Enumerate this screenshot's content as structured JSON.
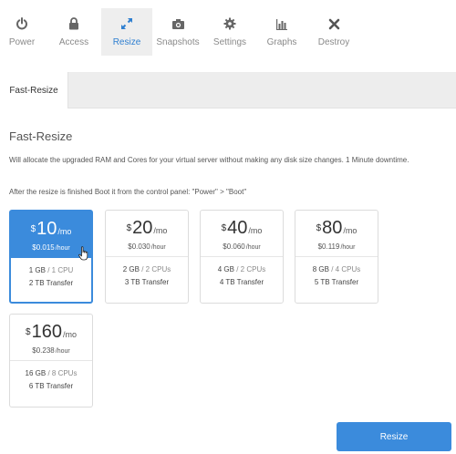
{
  "nav": {
    "items": [
      {
        "label": "Power",
        "icon": "power-icon"
      },
      {
        "label": "Access",
        "icon": "lock-icon"
      },
      {
        "label": "Resize",
        "icon": "resize-arrows-icon",
        "active": true
      },
      {
        "label": "Snapshots",
        "icon": "camera-icon"
      },
      {
        "label": "Settings",
        "icon": "gear-icon"
      },
      {
        "label": "Graphs",
        "icon": "bar-chart-icon"
      },
      {
        "label": "Destroy",
        "icon": "close-icon"
      }
    ]
  },
  "tabs": [
    {
      "label": "Fast-Resize",
      "active": true
    }
  ],
  "section": {
    "title": "Fast-Resize",
    "description": "Will allocate the upgraded RAM and Cores for your virtual server without making any disk size changes. 1 Minute downtime.",
    "note": "After the resize is finished Boot it from the control panel: \"Power\" > \"Boot\""
  },
  "plans": [
    {
      "currency": "$",
      "price": "10",
      "per": "/mo",
      "hourly": "$0.015",
      "hour_unit": "/hour",
      "ram": "1 GB",
      "cpu": "/ 1 CPU",
      "transfer": "2 TB Transfer",
      "selected": true
    },
    {
      "currency": "$",
      "price": "20",
      "per": "/mo",
      "hourly": "$0.030",
      "hour_unit": "/hour",
      "ram": "2 GB",
      "cpu": "/ 2 CPUs",
      "transfer": "3 TB Transfer"
    },
    {
      "currency": "$",
      "price": "40",
      "per": "/mo",
      "hourly": "$0.060",
      "hour_unit": "/hour",
      "ram": "4 GB",
      "cpu": "/ 2 CPUs",
      "transfer": "4 TB Transfer"
    },
    {
      "currency": "$",
      "price": "80",
      "per": "/mo",
      "hourly": "$0.119",
      "hour_unit": "/hour",
      "ram": "8 GB",
      "cpu": "/ 4 CPUs",
      "transfer": "5 TB Transfer"
    },
    {
      "currency": "$",
      "price": "160",
      "per": "/mo",
      "hourly": "$0.238",
      "hour_unit": "/hour",
      "ram": "16 GB",
      "cpu": "/ 8 CPUs",
      "transfer": "6 TB Transfer"
    }
  ],
  "actions": {
    "resize_label": "Resize"
  },
  "colors": {
    "accent": "#3b8bdc",
    "nav_icon": "#666666",
    "nav_active_icon": "#2e7fd0"
  }
}
